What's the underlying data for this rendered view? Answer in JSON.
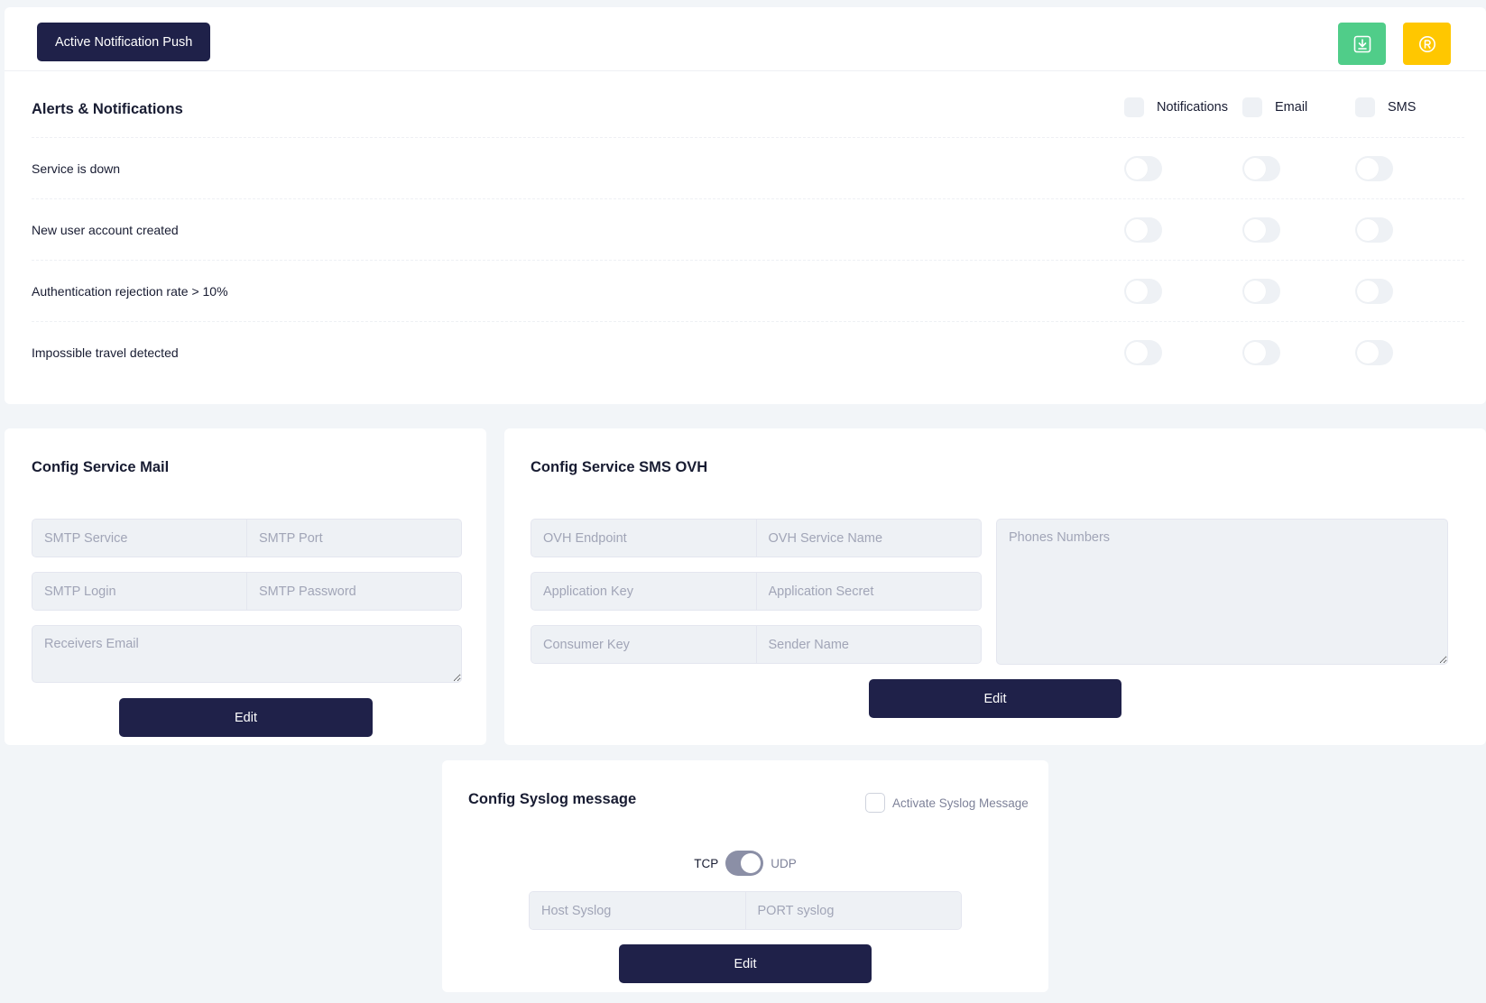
{
  "header": {
    "push_button": "Active Notification Push",
    "download_icon": "download-icon",
    "registered_icon": "registered-icon",
    "colors": {
      "primary": "#1f2149",
      "green": "#50cd89",
      "yellow": "#ffc700"
    }
  },
  "alerts": {
    "title": "Alerts & Notifications",
    "columns": [
      "Notifications",
      "Email",
      "SMS"
    ],
    "rows": [
      {
        "label": "Service is down"
      },
      {
        "label": "New user account created"
      },
      {
        "label": "Authentication rejection rate > 10%"
      },
      {
        "label": "Impossible travel detected"
      }
    ]
  },
  "mail": {
    "title": "Config Service Mail",
    "smtp_service": "SMTP Service",
    "smtp_port": "SMTP Port",
    "smtp_login": "SMTP Login",
    "smtp_password": "SMTP Password",
    "receivers": "Receivers Email",
    "edit": "Edit"
  },
  "sms": {
    "title": "Config Service SMS OVH",
    "ovh_endpoint": "OVH Endpoint",
    "ovh_service_name": "OVH Service Name",
    "app_key": "Application Key",
    "app_secret": "Application Secret",
    "consumer_key": "Consumer Key",
    "sender_name": "Sender Name",
    "phones": "Phones Numbers",
    "edit": "Edit"
  },
  "syslog": {
    "title": "Config Syslog message",
    "activate": "Activate Syslog Message",
    "tcp": "TCP",
    "udp": "UDP",
    "host": "Host Syslog",
    "port": "PORT syslog",
    "edit": "Edit"
  }
}
